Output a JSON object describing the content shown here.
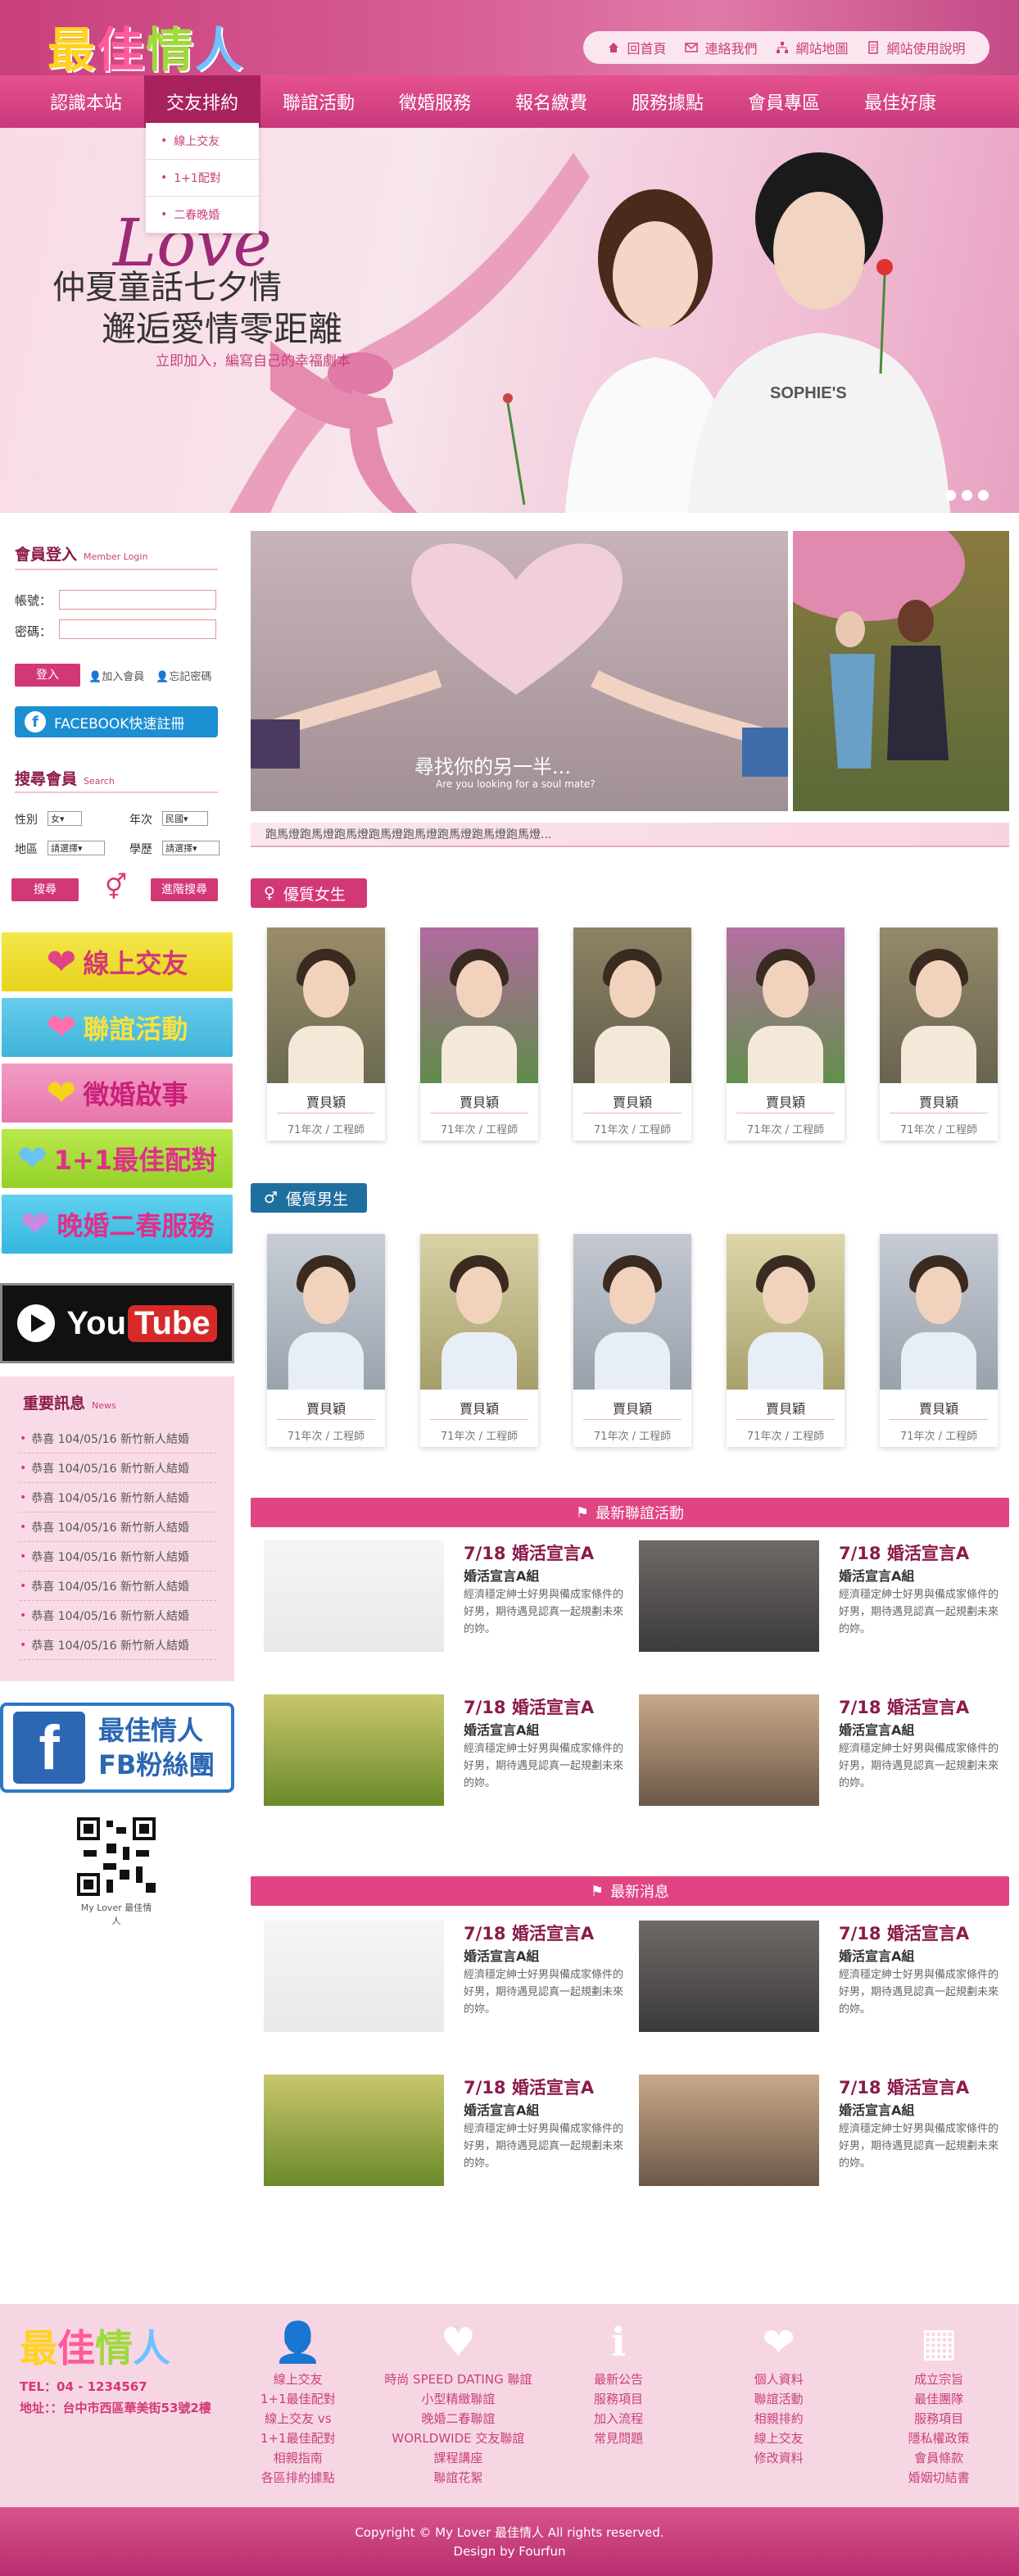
{
  "header": {
    "logo": [
      "最",
      "佳",
      "情",
      "人"
    ],
    "top_links": [
      "回首頁",
      "連絡我們",
      "網站地圖",
      "網站使用說明"
    ]
  },
  "nav": {
    "items": [
      "認識本站",
      "交友排約",
      "聯誼活動",
      "徵婚服務",
      "報名繳費",
      "服務據點",
      "會員專區",
      "最佳好康"
    ],
    "dropdown": [
      "線上交友",
      "1+1配對",
      "二春晚婚"
    ]
  },
  "banner": {
    "love": "Love",
    "line1": "仲夏童話七夕情",
    "line2": "邂逅愛情零距離",
    "sub": "立即加入，編寫自己的幸福劇本",
    "shirt_text": "SOPHIE'S"
  },
  "login": {
    "title": "會員登入",
    "title_en": "Member Login",
    "account_label": "帳號：",
    "password_label": "密碼：",
    "login_button": "登入",
    "join_link": "加入會員",
    "forgot_link": "忘記密碼",
    "facebook_button": "FACEBOOK快速註冊"
  },
  "search": {
    "title": "搜尋會員",
    "title_en": "Search",
    "gender_label": "性別",
    "gender_value": "女",
    "age_label": "年次",
    "age_value": "民國",
    "area_label": "地區",
    "area_value": "請選擇",
    "edu_label": "學歷",
    "edu_value": "請選擇",
    "search_button": "搜尋",
    "advanced_button": "進階搜尋"
  },
  "side_buttons": [
    "線上交友",
    "聯誼活動",
    "徵婚啟事",
    "1+1最佳配對",
    "晚婚二春服務"
  ],
  "youtube": {
    "you": "You",
    "tube": "Tube"
  },
  "news": {
    "title": "重要訊息",
    "title_en": "News",
    "items": [
      "恭喜 104/05/16 新竹新人結婚",
      "恭喜 104/05/16 新竹新人結婚",
      "恭喜 104/05/16 新竹新人結婚",
      "恭喜 104/05/16 新竹新人結婚",
      "恭喜 104/05/16 新竹新人結婚",
      "恭喜 104/05/16 新竹新人結婚",
      "恭喜 104/05/16 新竹新人結婚",
      "恭喜 104/05/16 新竹新人結婚"
    ]
  },
  "fb_fans": {
    "line1": "最佳情人",
    "line2": "FB粉絲團"
  },
  "qr_caption": "My Lover 最佳情人",
  "hero": {
    "caption": "尋找你的另一半...",
    "caption_en": "Are you looking for a soul mate?",
    "marquee": "跑馬燈跑馬燈跑馬燈跑馬燈跑馬燈跑馬燈跑馬燈跑馬燈..."
  },
  "female": {
    "title": "優質女生",
    "members": [
      {
        "name": "賈貝穎",
        "meta": "71年次 / 工程師"
      },
      {
        "name": "賈貝穎",
        "meta": "71年次 / 工程師"
      },
      {
        "name": "賈貝穎",
        "meta": "71年次 / 工程師"
      },
      {
        "name": "賈貝穎",
        "meta": "71年次 / 工程師"
      },
      {
        "name": "賈貝穎",
        "meta": "71年次 / 工程師"
      }
    ]
  },
  "male": {
    "title": "優質男生",
    "members": [
      {
        "name": "賈貝穎",
        "meta": "71年次 / 工程師"
      },
      {
        "name": "賈貝穎",
        "meta": "71年次 / 工程師"
      },
      {
        "name": "賈貝穎",
        "meta": "71年次 / 工程師"
      },
      {
        "name": "賈貝穎",
        "meta": "71年次 / 工程師"
      },
      {
        "name": "賈貝穎",
        "meta": "71年次 / 工程師"
      }
    ]
  },
  "activities": {
    "title": "最新聯誼活動",
    "items": [
      {
        "title": "7/18 婚活宣言A",
        "subtitle": "婚活宣言A組",
        "desc": "經濟穩定紳士好男與備成家條件的好男，期待遇見認真一起規劃未來的妳。"
      },
      {
        "title": "7/18 婚活宣言A",
        "subtitle": "婚活宣言A組",
        "desc": "經濟穩定紳士好男與備成家條件的好男，期待遇見認真一起規劃未來的妳。"
      },
      {
        "title": "7/18 婚活宣言A",
        "subtitle": "婚活宣言A組",
        "desc": "經濟穩定紳士好男與備成家條件的好男，期待遇見認真一起規劃未來的妳。"
      },
      {
        "title": "7/18 婚活宣言A",
        "subtitle": "婚活宣言A組",
        "desc": "經濟穩定紳士好男與備成家條件的好男，期待遇見認真一起規劃未來的妳。"
      }
    ]
  },
  "latest_news": {
    "title": "最新消息",
    "items": [
      {
        "title": "7/18 婚活宣言A",
        "subtitle": "婚活宣言A組",
        "desc": "經濟穩定紳士好男與備成家條件的好男，期待遇見認真一起規劃未來的妳。"
      },
      {
        "title": "7/18 婚活宣言A",
        "subtitle": "婚活宣言A組",
        "desc": "經濟穩定紳士好男與備成家條件的好男，期待遇見認真一起規劃未來的妳。"
      },
      {
        "title": "7/18 婚活宣言A",
        "subtitle": "婚活宣言A組",
        "desc": "經濟穩定紳士好男與備成家條件的好男，期待遇見認真一起規劃未來的妳。"
      },
      {
        "title": "7/18 婚活宣言A",
        "subtitle": "婚活宣言A組",
        "desc": "經濟穩定紳士好男與備成家條件的好男，期待遇見認真一起規劃未來的妳。"
      }
    ]
  },
  "footer": {
    "tel": "TEL：04 - 1234567",
    "address": "地址：：台中市西區華美街53號2樓",
    "columns": [
      {
        "icon": "add-user-icon",
        "links": [
          "線上交友",
          "1+1最佳配對",
          "線上交友 vs",
          "1+1最佳配對",
          "相親指南",
          "各區排約據點"
        ]
      },
      {
        "icon": "heartbeat-icon",
        "links": [
          "時尚 SPEED DATING 聯誼",
          "小型精緻聯誼",
          "晚婚二春聯誼",
          "WORLDWIDE 交友聯誼",
          "課程講座",
          "聯誼花絮"
        ]
      },
      {
        "icon": "info-icon",
        "links": [
          "最新公告",
          "服務項目",
          "加入流程",
          "常見問題"
        ]
      },
      {
        "icon": "heart-icon",
        "links": [
          "個人資料",
          "聯誼活動",
          "相親排約",
          "線上交友",
          "修改資料"
        ]
      },
      {
        "icon": "sitemap-icon",
        "links": [
          "成立宗旨",
          "最佳團隊",
          "服務項目",
          "隱私權政策",
          "會員條款",
          "婚姻切結書"
        ]
      }
    ],
    "copyright": "Copyright © My Lover 最佳情人 All rights reserved.",
    "design": "Design by Fourfun"
  },
  "colors": {
    "brand": "#d33876",
    "dark": "#8b1a4a",
    "female_tag": "#d33876",
    "male_tag": "#1f6f9e"
  }
}
